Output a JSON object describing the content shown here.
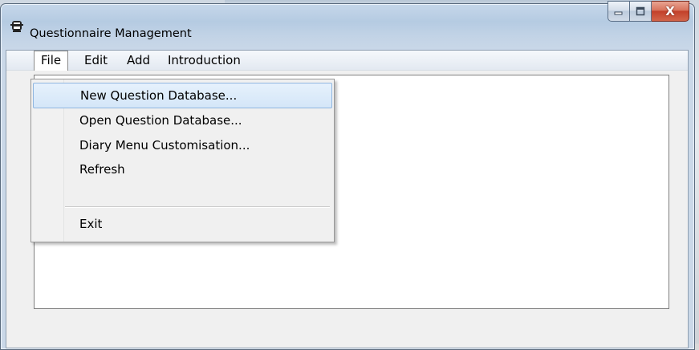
{
  "window": {
    "title": "Questionnaire Management"
  },
  "menubar": {
    "items": [
      {
        "label": "File"
      },
      {
        "label": "Edit"
      },
      {
        "label": "Add"
      },
      {
        "label": "Introduction"
      }
    ]
  },
  "file_menu": {
    "items": [
      {
        "label": "New Question Database..."
      },
      {
        "label": "Open Question Database..."
      },
      {
        "label": "Diary Menu Customisation..."
      },
      {
        "label": "Refresh"
      },
      {
        "label": "Exit"
      }
    ]
  },
  "caption_buttons": {
    "close_glyph": "X"
  },
  "icons": {
    "app": "questionnaire-app-icon",
    "minimize": "minimize-icon",
    "maximize": "maximize-icon",
    "close": "close-icon"
  },
  "colors": {
    "highlight": "#d4e6f8",
    "close_button": "#c2402a"
  }
}
